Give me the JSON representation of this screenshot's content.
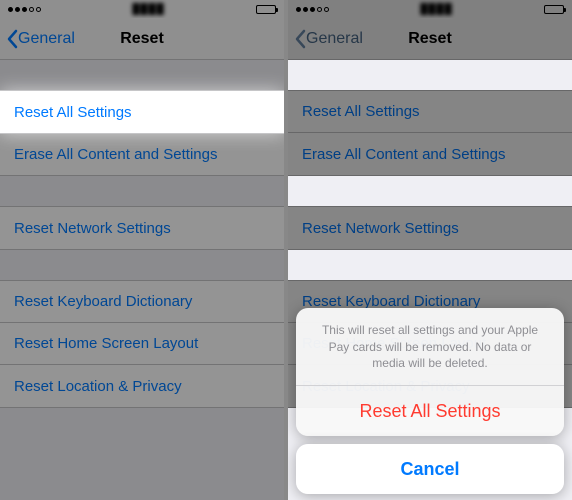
{
  "nav": {
    "back": "General",
    "title": "Reset"
  },
  "items": {
    "reset_all_settings": "Reset All Settings",
    "erase_all": "Erase All Content and Settings",
    "reset_network": "Reset Network Settings",
    "reset_keyboard": "Reset Keyboard Dictionary",
    "reset_home": "Reset Home Screen Layout",
    "reset_location": "Reset Location & Privacy"
  },
  "sheet": {
    "message": "This will reset all settings and your Apple Pay cards will be removed. No data or media will be deleted.",
    "action": "Reset All Settings",
    "cancel": "Cancel"
  },
  "highlight_label": "Reset All Settings"
}
